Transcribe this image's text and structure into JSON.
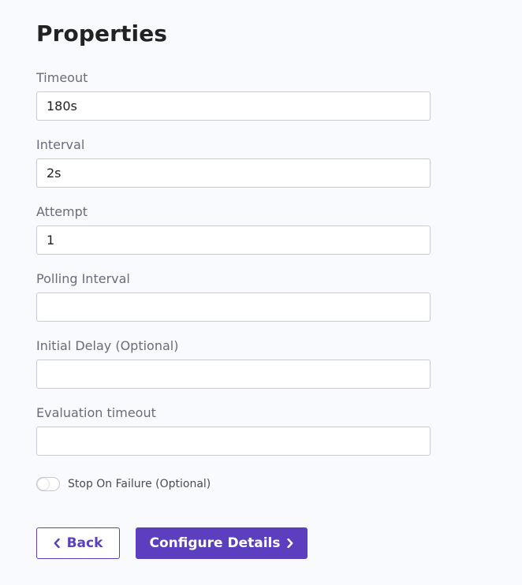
{
  "page": {
    "title": "Properties"
  },
  "fields": [
    {
      "label": "Timeout",
      "value": "180s",
      "placeholder": ""
    },
    {
      "label": "Interval",
      "value": "2s",
      "placeholder": ""
    },
    {
      "label": "Attempt",
      "value": "1",
      "placeholder": ""
    },
    {
      "label": "Polling Interval",
      "value": "",
      "placeholder": ""
    },
    {
      "label": "Initial Delay (Optional)",
      "value": "",
      "placeholder": ""
    },
    {
      "label": "Evaluation timeout",
      "value": "",
      "placeholder": ""
    }
  ],
  "toggle": {
    "label": "Stop On Failure (Optional)",
    "on": false
  },
  "buttons": {
    "back_label": "Back",
    "next_label": "Configure Details",
    "back_icon": "chevron-left-icon",
    "next_icon": "chevron-right-icon"
  },
  "colors": {
    "accent": "#5b3fbf",
    "background": "#f8fafd",
    "input_border": "#c9c9d4",
    "label_text": "#6b6b7b"
  }
}
